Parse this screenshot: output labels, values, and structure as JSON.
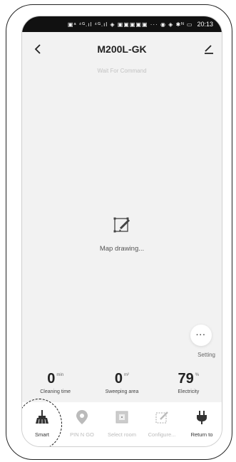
{
  "statusbar": {
    "icons": "▣ᵃ ⁴ᴳ.ıl ⁴ᴳ.ıl ◈ ▣▣▣▣▣ ···  ◉ ◈ ✱ᴺ ▭",
    "time": "20:13"
  },
  "header": {
    "title": "M200L-GK"
  },
  "status_text": "Wait For Command",
  "map": {
    "label": "Map drawing..."
  },
  "setting": {
    "glyph": "···",
    "label": "Setting"
  },
  "stats": [
    {
      "value": "0",
      "unit": "min",
      "label": "Cleaning time"
    },
    {
      "value": "0",
      "unit": "m²",
      "label": "Sweeping area"
    },
    {
      "value": "79",
      "unit": "%",
      "label": "Electricity"
    }
  ],
  "nav": [
    {
      "label": "Smart",
      "icon": "broom-icon"
    },
    {
      "label": "PIN N GO",
      "icon": "location-pin-icon"
    },
    {
      "label": "Select room",
      "icon": "room-select-icon"
    },
    {
      "label": "Configure...",
      "icon": "configure-icon"
    },
    {
      "label": "Return to",
      "icon": "plug-icon"
    }
  ],
  "colors": {
    "active": "#333333",
    "inactive": "#bbbbbb",
    "background": "#f2f2f2"
  }
}
